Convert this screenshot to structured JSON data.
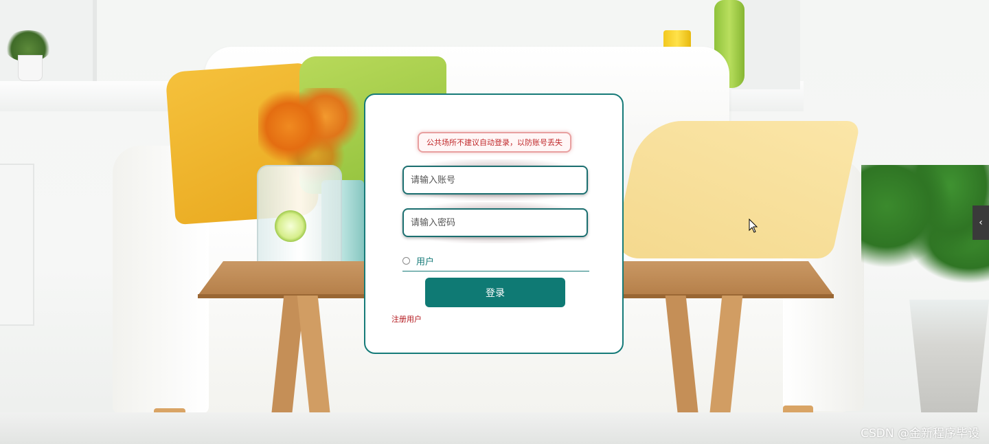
{
  "login": {
    "notice": "公共场所不建议自动登录，以防账号丢失",
    "username_placeholder": "请输入账号",
    "password_placeholder": "请输入密码",
    "role_label": "用户",
    "login_button": "登录",
    "register_link": "注册用户"
  },
  "side_toggle": {
    "icon": "chevron-left-icon",
    "glyph": "‹"
  },
  "watermark": "CSDN @金新程序毕设",
  "colors": {
    "accent": "#0f7a74",
    "card_border": "#157a78",
    "notice_text": "#c0282a",
    "register_text": "#b3161c"
  }
}
